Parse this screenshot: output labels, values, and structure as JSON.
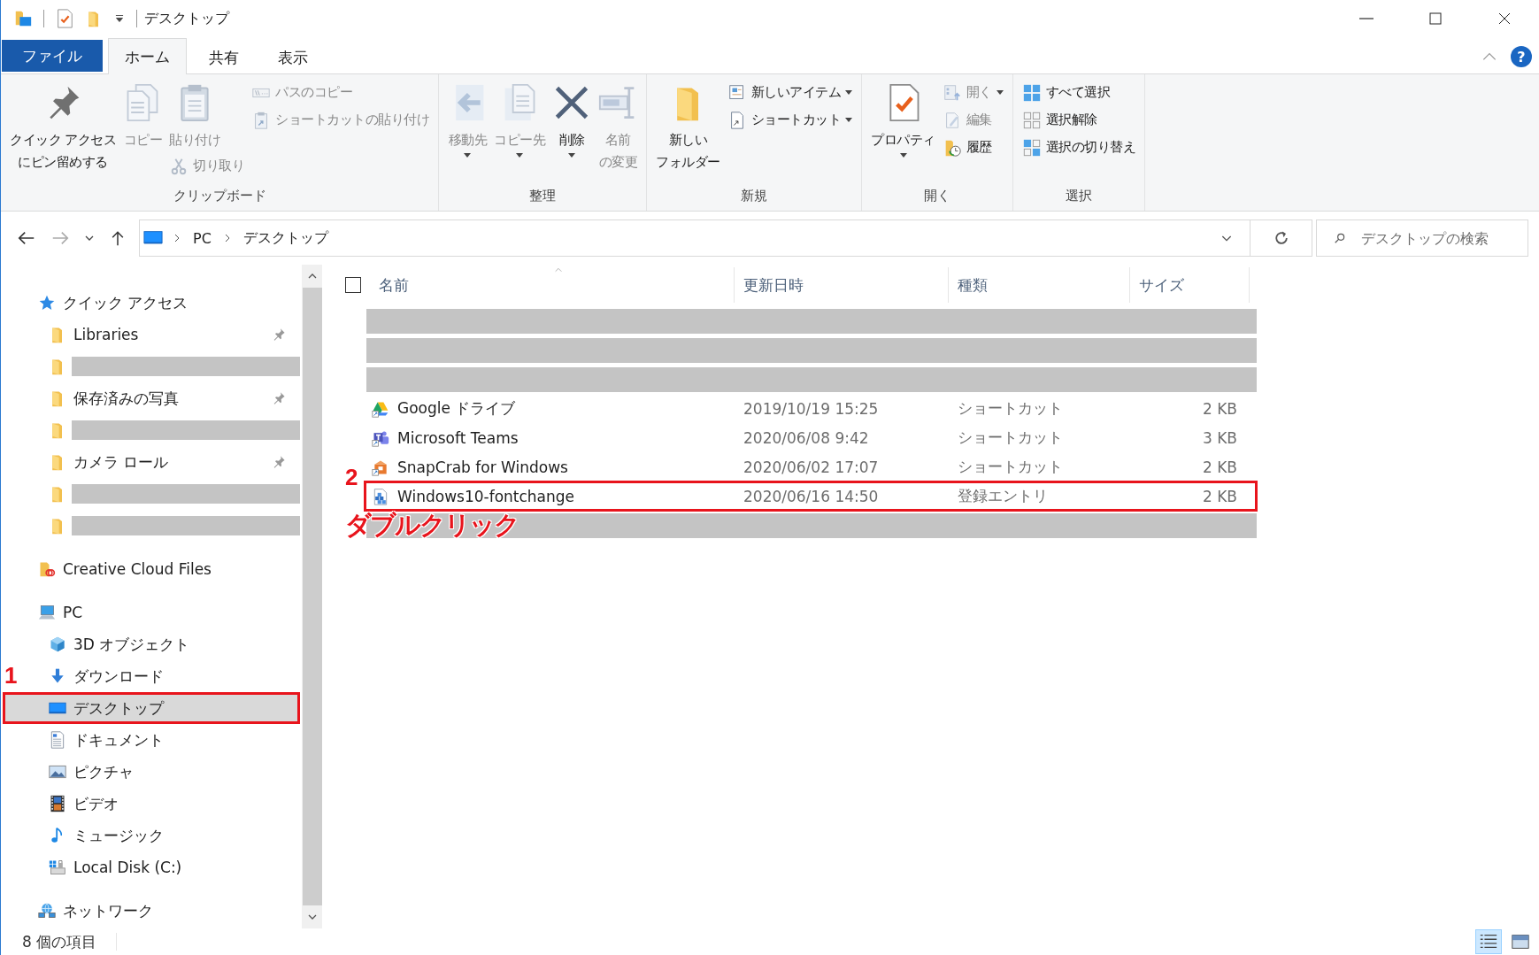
{
  "title_bar": {
    "title": "デスクトップ"
  },
  "ribbon_tabs": [
    {
      "label": "ファイル",
      "kind": "file",
      "selected": false
    },
    {
      "label": "ホーム",
      "kind": "tab",
      "selected": true
    },
    {
      "label": "共有",
      "kind": "tab",
      "selected": false
    },
    {
      "label": "表示",
      "kind": "tab",
      "selected": false
    }
  ],
  "help_button": {
    "label": "?"
  },
  "ribbon_groups": [
    {
      "label": "クリップボード",
      "columns": [
        [
          {
            "lines": [
              "クイック アクセス",
              "にピン留めする"
            ],
            "kind": "large",
            "disabled": false,
            "dropdown": false
          }
        ],
        [
          {
            "label": "コピー",
            "kind": "large",
            "disabled": true,
            "dropdown": false
          }
        ],
        [
          {
            "label": "貼り付け",
            "kind": "large",
            "disabled": true,
            "dropdown": false
          },
          {
            "label": "切り取り",
            "kind": "small",
            "disabled": true,
            "dropdown": false
          }
        ],
        [
          {
            "label": "パスのコピー",
            "kind": "small",
            "disabled": true,
            "dropdown": false
          },
          {
            "label": "ショートカットの貼り付け",
            "kind": "small",
            "disabled": true,
            "dropdown": false
          }
        ]
      ]
    },
    {
      "label": "整理",
      "columns": [
        [
          {
            "label": "移動先",
            "kind": "large",
            "disabled": true,
            "dropdown": true
          }
        ],
        [
          {
            "label": "コピー先",
            "kind": "large",
            "disabled": true,
            "dropdown": true
          }
        ],
        [
          {
            "label": "削除",
            "kind": "large",
            "disabled": false,
            "dropdown": true
          }
        ],
        [
          {
            "lines": [
              "名前",
              "の変更"
            ],
            "kind": "large",
            "disabled": true,
            "dropdown": false
          }
        ]
      ]
    },
    {
      "label": "新規",
      "columns": [
        [
          {
            "lines": [
              "新しい",
              "フォルダー"
            ],
            "kind": "large",
            "disabled": false,
            "dropdown": false
          }
        ],
        [
          {
            "label": "新しいアイテム",
            "kind": "small",
            "disabled": false,
            "dropdown": true
          },
          {
            "label": "ショートカット",
            "kind": "small",
            "disabled": false,
            "dropdown": true
          }
        ]
      ]
    },
    {
      "label": "開く",
      "columns": [
        [
          {
            "label": "プロパティ",
            "kind": "large",
            "disabled": false,
            "dropdown": true
          }
        ],
        [
          {
            "label": "開く",
            "kind": "small",
            "disabled": true,
            "dropdown": true
          },
          {
            "label": "編集",
            "kind": "small",
            "disabled": true,
            "dropdown": false
          },
          {
            "label": "履歴",
            "kind": "small",
            "disabled": false,
            "dropdown": false
          }
        ]
      ]
    },
    {
      "label": "選択",
      "columns": [
        [
          {
            "label": "すべて選択",
            "kind": "small",
            "disabled": false,
            "dropdown": false
          },
          {
            "label": "選択解除",
            "kind": "small",
            "disabled": false,
            "dropdown": false
          },
          {
            "label": "選択の切り替え",
            "kind": "small",
            "disabled": false,
            "dropdown": false
          }
        ]
      ]
    }
  ],
  "address_bar": {
    "path": [
      "PC",
      "デスクトップ"
    ]
  },
  "search": {
    "placeholder": "デスクトップの検索"
  },
  "nav_pane": {
    "items": [
      {
        "label": "クイック アクセス",
        "kind": "node",
        "selected": false,
        "children": [
          {
            "label": "Libraries",
            "kind": "node",
            "selected": false,
            "pinned": true
          },
          {
            "kind": "redacted"
          },
          {
            "label": "保存済みの写真",
            "kind": "node",
            "selected": false,
            "pinned": true
          },
          {
            "kind": "redacted"
          },
          {
            "label": "カメラ ロール",
            "kind": "node",
            "selected": false,
            "pinned": true
          },
          {
            "kind": "redacted"
          },
          {
            "kind": "redacted"
          }
        ]
      },
      {
        "label": "Creative Cloud Files",
        "kind": "node",
        "selected": false
      },
      {
        "label": "PC",
        "kind": "node",
        "selected": false,
        "children": [
          {
            "label": "3D オブジェクト",
            "kind": "node",
            "selected": false
          },
          {
            "label": "ダウンロード",
            "kind": "node",
            "selected": false
          },
          {
            "label": "デスクトップ",
            "kind": "node",
            "selected": true,
            "callout": "1"
          },
          {
            "label": "ドキュメント",
            "kind": "node",
            "selected": false
          },
          {
            "label": "ピクチャ",
            "kind": "node",
            "selected": false
          },
          {
            "label": "ビデオ",
            "kind": "node",
            "selected": false
          },
          {
            "label": "ミュージック",
            "kind": "node",
            "selected": false
          },
          {
            "label": "Local Disk (C:)",
            "kind": "node",
            "selected": false
          }
        ]
      },
      {
        "label": "ネットワーク",
        "kind": "node",
        "selected": false
      }
    ]
  },
  "file_list": {
    "select_all": {
      "checked": false
    },
    "columns": [
      {
        "label": "名前",
        "sorted": true
      },
      {
        "label": "更新日時",
        "sorted": false
      },
      {
        "label": "種類",
        "sorted": false
      },
      {
        "label": "サイズ",
        "sorted": false
      }
    ],
    "rows": [
      {
        "kind": "redacted"
      },
      {
        "kind": "redacted"
      },
      {
        "kind": "redacted"
      },
      {
        "kind": "file",
        "name": "Google ドライブ",
        "modified": "2019/10/19 15:25",
        "type": "ショートカット",
        "size": "2 KB",
        "selected": false
      },
      {
        "kind": "file",
        "name": "Microsoft Teams",
        "modified": "2020/06/08 9:42",
        "type": "ショートカット",
        "size": "3 KB",
        "selected": false
      },
      {
        "kind": "file",
        "name": "SnapCrab for Windows",
        "modified": "2020/06/02 17:07",
        "type": "ショートカット",
        "size": "2 KB",
        "selected": false
      },
      {
        "kind": "file",
        "name": "Windows10-fontchange",
        "modified": "2020/06/16 14:50",
        "type": "登録エントリ",
        "size": "2 KB",
        "selected": false,
        "callout": "2",
        "callout_note": "ダブルクリック"
      },
      {
        "kind": "redacted"
      }
    ]
  },
  "status_bar": {
    "item_count": "8 個の項目",
    "views": [
      {
        "selected": true
      },
      {
        "selected": false
      }
    ]
  }
}
